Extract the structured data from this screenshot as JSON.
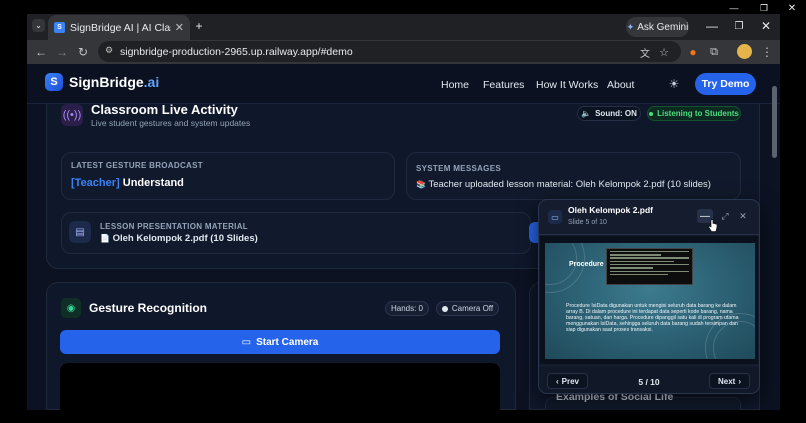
{
  "browser": {
    "tab_title": "SignBridge AI | AI Classroom Acc",
    "tab_favicon": "S",
    "gemini_label": "Ask Gemini",
    "url": "signbridge-production-2965.up.railway.app/#demo"
  },
  "site": {
    "logo_name": "SignBridge",
    "logo_suffix": ".ai",
    "logo_mark": "S",
    "nav": [
      "Home",
      "Features",
      "How It Works",
      "About"
    ],
    "cta": "Try Demo"
  },
  "activity": {
    "title": "Classroom Live Activity",
    "subtitle": "Live student gestures and system updates",
    "sound_label": "Sound: ON",
    "listening_label": "Listening to Students",
    "gesture_label": "LATEST GESTURE BROADCAST",
    "gesture_role": "[Teacher]",
    "gesture_text": "Understand",
    "system_label": "SYSTEM MESSAGES",
    "system_text": "Teacher uploaded lesson material: Oleh Kelompok 2.pdf (10 slides)",
    "lesson_label": "LESSON PRESENTATION MATERIAL",
    "lesson_file": "Oleh Kelompok 2.pdf (10 Slides)"
  },
  "gesture": {
    "title": "Gesture Recognition",
    "hands": "Hands: 0",
    "camera_status": "Camera Off",
    "start_button": "Start Camera"
  },
  "right": {
    "examples_title": "Examples of Social Life"
  },
  "viewer": {
    "title": "Oleh Kelompok 2.pdf",
    "slide_label": "Slide 5 of 10",
    "slide_heading": "Procedure",
    "slide_body": "Procedure IsiData digunakan untuk mengisi seluruh data barang ke dalam array B. Di dalam procedure ini terdapat data seperti kode barang, nama barang, satuan, dan harga. Procedure dipanggil satu kali di program utama menggunakan IsiData, sehingga seluruh data barang sudah tersimpan dan siap digunakan saat proses transaksi.",
    "prev": "Prev",
    "next": "Next",
    "page": "5 / 10"
  }
}
